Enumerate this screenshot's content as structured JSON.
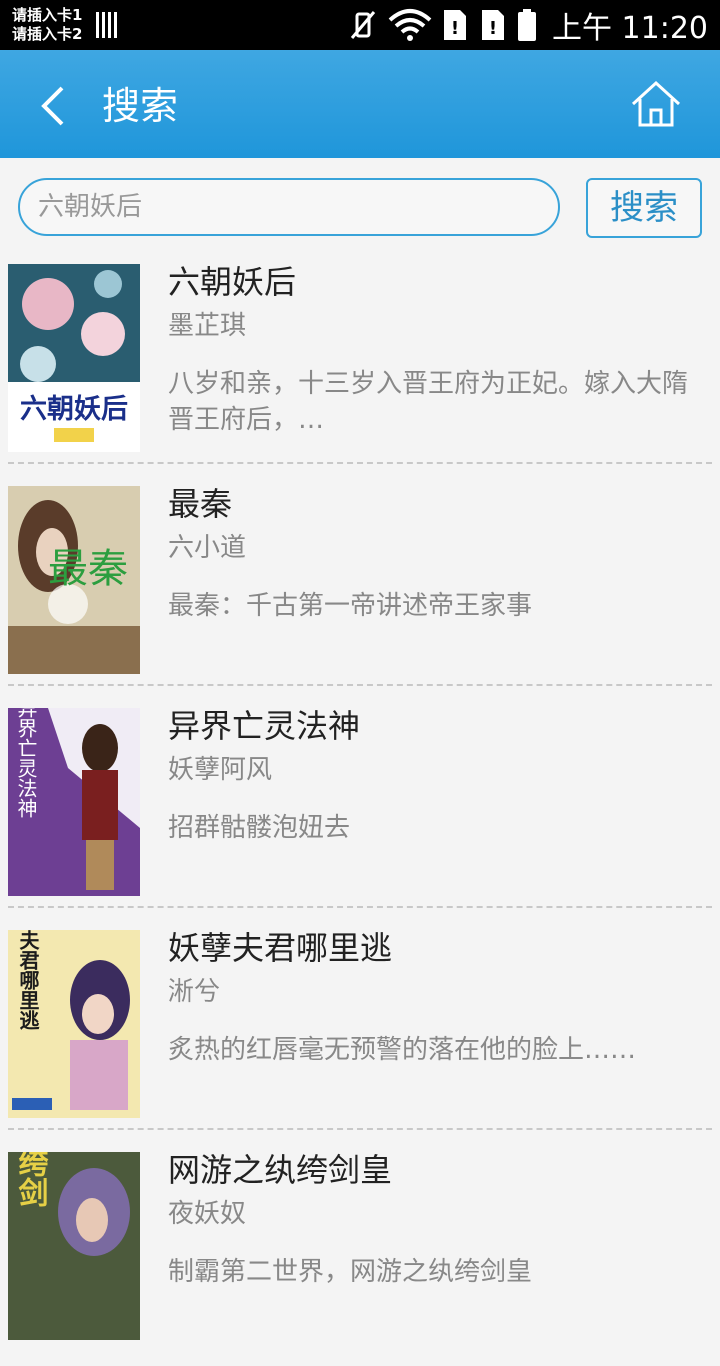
{
  "status_bar": {
    "sim1": "请插入卡1",
    "sim2": "请插入卡2",
    "time": "上午 11:20",
    "icons": [
      "vibrate-off-icon",
      "wifi-icon",
      "sim-alert-icon",
      "sim-alert-icon",
      "battery-icon"
    ]
  },
  "header": {
    "title": "搜索",
    "back_icon": "chevron-left-icon",
    "home_icon": "home-icon"
  },
  "search": {
    "value": "六朝妖后",
    "button_label": "搜索"
  },
  "results": [
    {
      "title": "六朝妖后",
      "author": "墨芷琪",
      "desc": "八岁和亲，十三岁入晋王府为正妃。嫁入大隋晋王府后，…",
      "cover_text": "六朝妖后"
    },
    {
      "title": "最秦",
      "author": "六小道",
      "desc": "最秦：千古第一帝讲述帝王家事",
      "cover_text": "最秦"
    },
    {
      "title": "异界亡灵法神",
      "author": "妖孽阿风",
      "desc": "招群骷髅泡妞去",
      "cover_text": "异界亡灵法神"
    },
    {
      "title": "妖孽夫君哪里逃",
      "author": "淅兮",
      "desc": "炙热的红唇毫无预警的落在他的脸上……",
      "cover_text": "妖孽夫君哪里逃"
    },
    {
      "title": "网游之纨绔剑皇",
      "author": "夜妖奴",
      "desc": "制霸第二世界，网游之纨绔剑皇",
      "cover_text": "纨绔剑"
    }
  ],
  "colors": {
    "accent": "#1f96da",
    "border": "#38a3d9"
  }
}
